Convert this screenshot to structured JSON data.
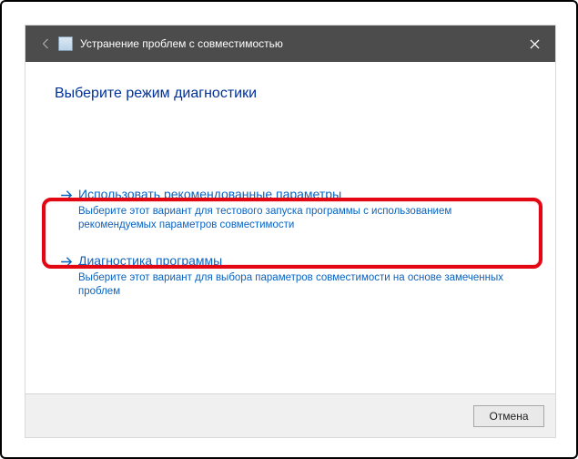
{
  "titlebar": {
    "back_icon": "back-arrow",
    "app_icon": "troubleshooter-app",
    "title": "Устранение проблем с совместимостью",
    "close_icon": "close"
  },
  "heading": "Выберите режим диагностики",
  "options": [
    {
      "title": "Использовать рекомендованные параметры",
      "desc": "Выберите этот вариант для тестового запуска программы с использованием рекомендуемых параметров совместимости"
    },
    {
      "title": "Диагностика программы",
      "desc": "Выберите этот вариант для выбора параметров совместимости на основе замеченных проблем"
    }
  ],
  "footer": {
    "cancel": "Отмена"
  },
  "accent_color": "#0a63c0",
  "highlight_color": "#e30613"
}
